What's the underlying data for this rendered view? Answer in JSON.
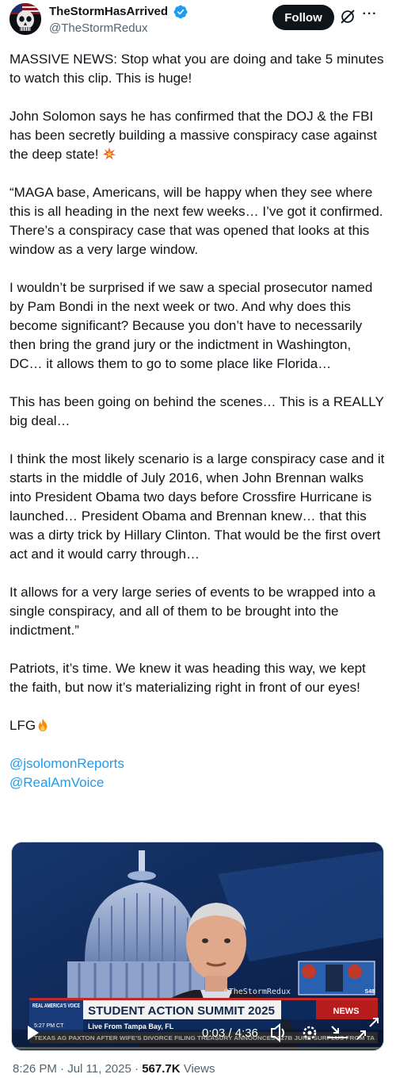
{
  "author": {
    "name": "TheStormHasArrived",
    "handle": "@TheStormRedux",
    "avatar_icon": "skull-flag-avatar"
  },
  "actions": {
    "follow_label": "Follow",
    "more_label": "···"
  },
  "tweet": {
    "paragraphs": [
      "MASSIVE NEWS: Stop what you are doing and take 5 minutes to watch this clip. This is huge!",
      "John Solomon says he has confirmed that the DOJ & the FBI has been secretly building a massive conspiracy case against the deep state!",
      "“MAGA base, Americans, will be happy when they see where this is all heading in the next few weeks… I’ve got it confirmed. There’s a conspiracy case that was opened that looks at this window as a very large window.",
      "I wouldn’t be surprised if we saw a special prosecutor named by Pam Bondi in the next week or two. And why does this become significant? Because you don’t have to necessarily then bring the grand jury or the indictment in Washington, DC… it allows them to go to some place like Florida…",
      "This has been going on behind the scenes… This is a REALLY big deal…",
      "I think the most likely scenario is a large conspiracy case and it starts in the middle of July 2016, when John Brennan walks into President Obama two days before Crossfire Hurricane is launched… President Obama and Brennan knew… that this was a dirty trick by Hillary Clinton. That would be the first overt act and it would carry through…",
      "It allows for a very large series of events to be wrapped into a single conspiracy, and all of them to be brought into the indictment.”",
      "Patriots, it’s time. We knew it was heading this way, we kept the faith, but now it’s materializing right in front of our eyes!",
      "LFG"
    ],
    "mentions": [
      "@jsolomonReports",
      "@RealAmVoice"
    ]
  },
  "video": {
    "watermark": "@TheStormRedux",
    "network": "REAL AMERICA'S VOICE",
    "headline": "STUDENT ACTION SUMMIT 2025",
    "time_badge": "5:27 PM CT",
    "location": "Live From Tampa Bay, FL",
    "ticker": "TEXAS AG PAXTON AFTER WIFE'S DIVORCE FILING     TREASURY ANNOUNCES $27B JUNE SURPLUS FROM TA",
    "timecode": "0:03 / 4:36",
    "side_badge": "NEWS",
    "side_label": "S48",
    "progress_fraction": 0.011
  },
  "meta": {
    "time": "8:26 PM",
    "date": "Jul 11, 2025",
    "views_count": "567.7K",
    "views_label": "Views",
    "separator": "·"
  },
  "colors": {
    "link": "#1d9bf0",
    "verified": "#1d9bf0",
    "text": "#0f1419",
    "secondary": "#536471"
  }
}
